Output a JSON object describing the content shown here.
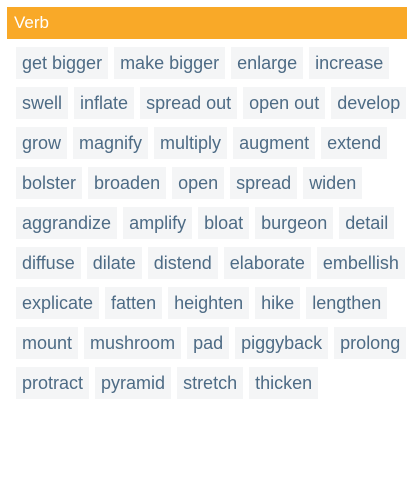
{
  "section": {
    "title": "Verb",
    "header_color": "#f9a928",
    "chip_text_color": "#4d6b85",
    "chip_bg_color": "#f4f5f6"
  },
  "words": [
    "get bigger",
    "make bigger",
    "enlarge",
    "increase",
    "swell",
    "inflate",
    "spread out",
    "open out",
    "develop",
    "grow",
    "magnify",
    "multiply",
    "augment",
    "extend",
    "bolster",
    "broaden",
    "open",
    "spread",
    "widen",
    "aggrandize",
    "amplify",
    "bloat",
    "burgeon",
    "detail",
    "diffuse",
    "dilate",
    "distend",
    "elaborate",
    "embellish",
    "explicate",
    "fatten",
    "heighten",
    "hike",
    "lengthen",
    "mount",
    "mushroom",
    "pad",
    "piggyback",
    "prolong",
    "protract",
    "pyramid",
    "stretch",
    "thicken"
  ]
}
